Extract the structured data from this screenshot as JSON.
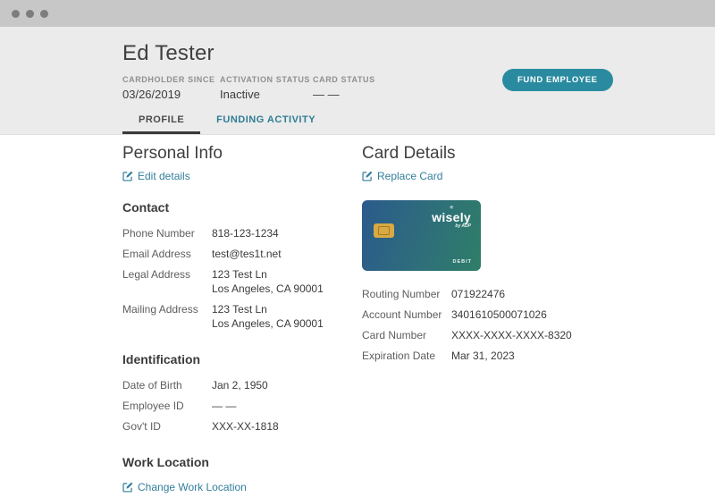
{
  "colors": {
    "accent_teal": "#2a8ba0",
    "link_teal": "#337e9b",
    "card_blue": "#2b5a8c",
    "card_green": "#2f7e68",
    "chip_gold": "#d9a943"
  },
  "header": {
    "name": "Ed Tester",
    "fund_button": "FUND EMPLOYEE",
    "meta": [
      {
        "label": "CARDHOLDER SINCE",
        "value": "03/26/2019"
      },
      {
        "label": "ACTIVATION STATUS",
        "value": "Inactive"
      },
      {
        "label": "CARD STATUS",
        "value": "— —"
      }
    ]
  },
  "tabs": [
    {
      "label": "PROFILE",
      "active": true
    },
    {
      "label": "FUNDING ACTIVITY",
      "active": false
    }
  ],
  "personal": {
    "title": "Personal Info",
    "edit_link": "Edit details",
    "contact": {
      "title": "Contact",
      "rows": [
        {
          "label": "Phone Number",
          "lines": [
            "818-123-1234"
          ]
        },
        {
          "label": "Email Address",
          "lines": [
            "test@tes1t.net"
          ]
        },
        {
          "label": "Legal Address",
          "lines": [
            "123 Test Ln",
            "Los Angeles, CA 90001"
          ]
        },
        {
          "label": "Mailing Address",
          "lines": [
            "123 Test Ln",
            "Los Angeles, CA 90001"
          ]
        }
      ]
    },
    "identification": {
      "title": "Identification",
      "rows": [
        {
          "label": "Date of Birth",
          "lines": [
            "Jan 2, 1950"
          ]
        },
        {
          "label": "Employee ID",
          "lines": [
            "— —"
          ]
        },
        {
          "label": "Gov't ID",
          "lines": [
            "XXX-XX-1818"
          ]
        }
      ]
    },
    "work_location": {
      "title": "Work Location",
      "change_link": "Change Work Location"
    }
  },
  "card": {
    "title": "Card Details",
    "replace_link": "Replace Card",
    "art": {
      "sparkle": "✳",
      "brand": "wisely",
      "by": "by ADP",
      "type": "DEBIT"
    },
    "rows": [
      {
        "label": "Routing Number",
        "value": "071922476"
      },
      {
        "label": "Account Number",
        "value": "3401610500071026"
      },
      {
        "label": "Card Number",
        "value": "XXXX-XXXX-XXXX-8320"
      },
      {
        "label": "Expiration Date",
        "value": "Mar 31, 2023"
      }
    ]
  }
}
